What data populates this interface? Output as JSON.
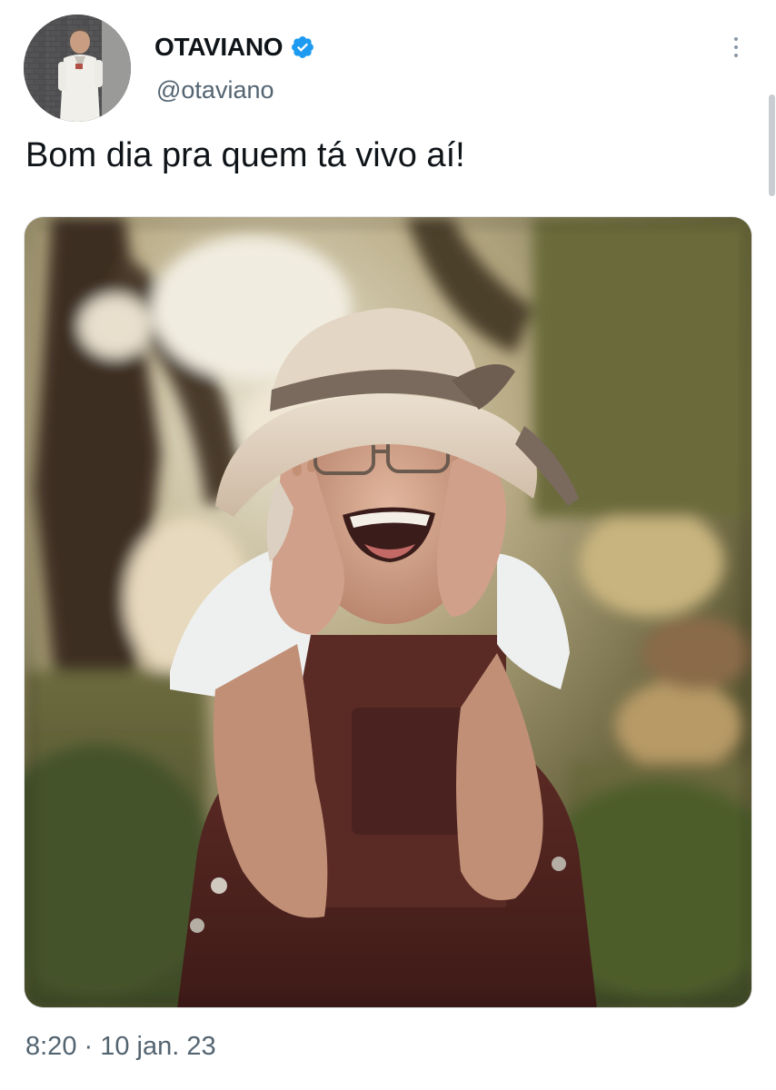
{
  "author": {
    "display_name": "OTAVIANO",
    "handle": "@otaviano",
    "verified": true
  },
  "tweet": {
    "text": "Bom dia pra quem tá vivo aí!",
    "timestamp": "8:20 · 10 jan. 23"
  },
  "icons": {
    "verified": "verified-badge-icon",
    "more": "more-options-icon"
  },
  "colors": {
    "verified_blue": "#1d9bf0",
    "secondary_text": "#536471",
    "primary_text": "#0f1419"
  }
}
